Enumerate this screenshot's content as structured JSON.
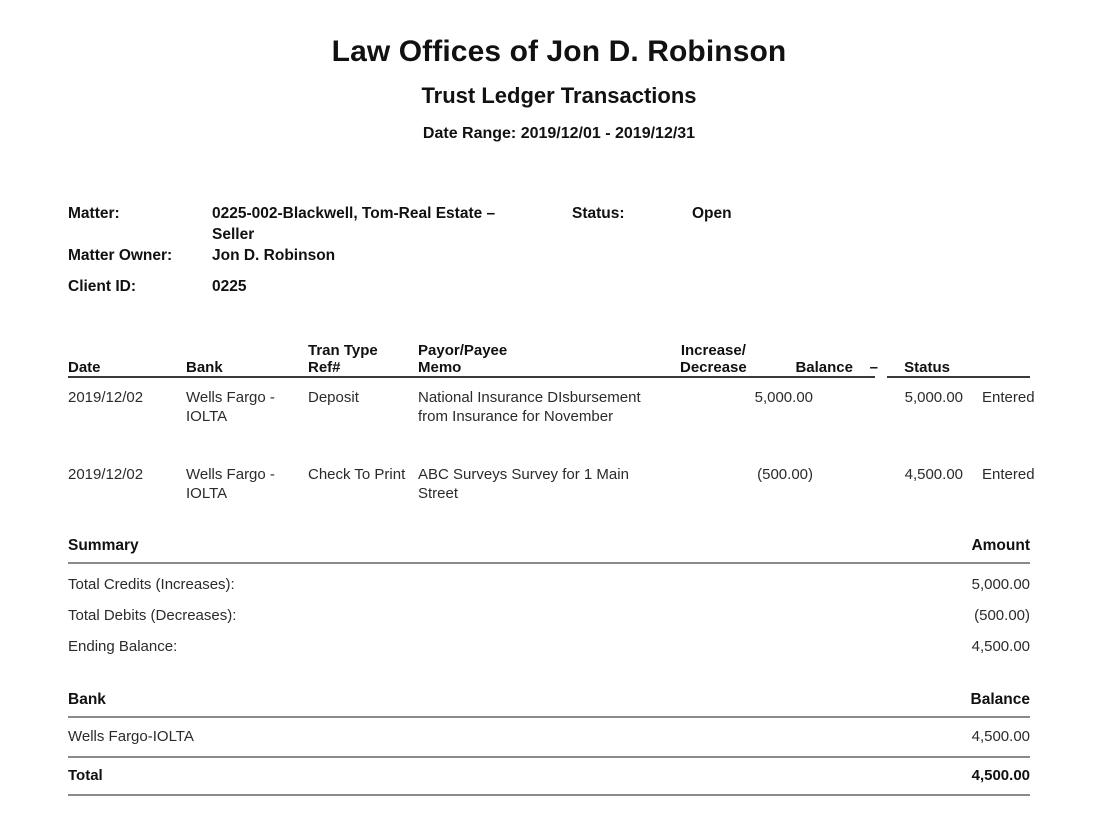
{
  "report": {
    "firm_name": "Law Offices of Jon D. Robinson",
    "report_title": "Trust Ledger Transactions",
    "date_range": "Date Range: 2019/12/01 - 2019/12/31"
  },
  "matter_info": {
    "matter_label": "Matter:",
    "matter_value": "0225-002-Blackwell, Tom-Real Estate – Seller",
    "status_label": "Status:",
    "status_value": "Open",
    "owner_label": "Matter Owner:",
    "owner_value": "Jon D. Robinson",
    "client_id_label": "Client ID:",
    "client_id_value": "0225"
  },
  "transactions": {
    "headers": {
      "date": "Date",
      "bank": "Bank",
      "tran_type": "Tran Type\nRef#",
      "payor_payee": "Payor/Payee\nMemo",
      "increase_decrease": "Increase/\nDecrease",
      "balance": "Balance",
      "separator": "–",
      "status": "Status"
    },
    "rows": [
      {
        "date": "2019/12/02",
        "bank": "Wells Fargo - IOLTA",
        "tran_type": "Deposit",
        "payor_payee": "National Insurance\nDIsbursement from Insurance\nfor November",
        "increase_decrease": "5,000.00",
        "balance": "5,000.00",
        "status": "Entered"
      },
      {
        "date": "2019/12/02",
        "bank": "Wells Fargo - IOLTA",
        "tran_type": "Check\nTo Print",
        "payor_payee": "ABC Surveys\nSurvey for 1 Main Street",
        "increase_decrease": "(500.00)",
        "balance": "4,500.00",
        "status": "Entered"
      }
    ]
  },
  "summary": {
    "title": "Summary",
    "amount_header": "Amount",
    "rows": [
      {
        "label": "Total Credits (Increases):",
        "amount": "5,000.00"
      },
      {
        "label": "Total Debits (Decreases):",
        "amount": "(500.00)"
      },
      {
        "label": "Ending Balance:",
        "amount": "4,500.00"
      }
    ]
  },
  "bank_summary": {
    "title": "Bank",
    "balance_header": "Balance",
    "rows": [
      {
        "label": "Wells Fargo-IOLTA",
        "balance": "4,500.00"
      }
    ],
    "total_label": "Total",
    "total_balance": "4,500.00"
  }
}
